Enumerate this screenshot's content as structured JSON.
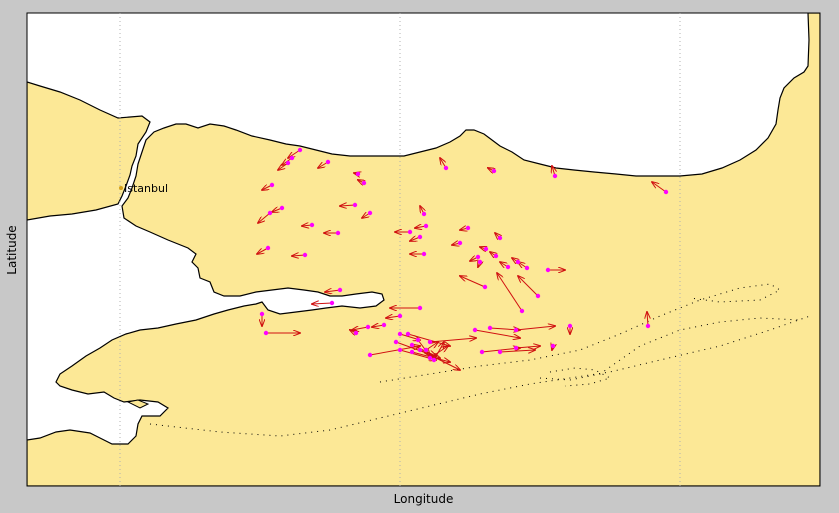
{
  "figure": {
    "xlabel": "Longitude",
    "ylabel": "Latitude"
  },
  "map": {
    "colors": {
      "land": "#fce896",
      "sea": "#ffffff",
      "coast": "#000000",
      "grid": "#b0b0b0",
      "vector": "#d01010",
      "station": "#ff00ff",
      "city": "#d4a017",
      "fault": "#000000",
      "frame_bg": "#c8c8c8"
    },
    "cities": [
      {
        "name": "Istanbul"
      }
    ],
    "station_marker": "magenta-dot",
    "vector_style": "red-arrow"
  }
}
